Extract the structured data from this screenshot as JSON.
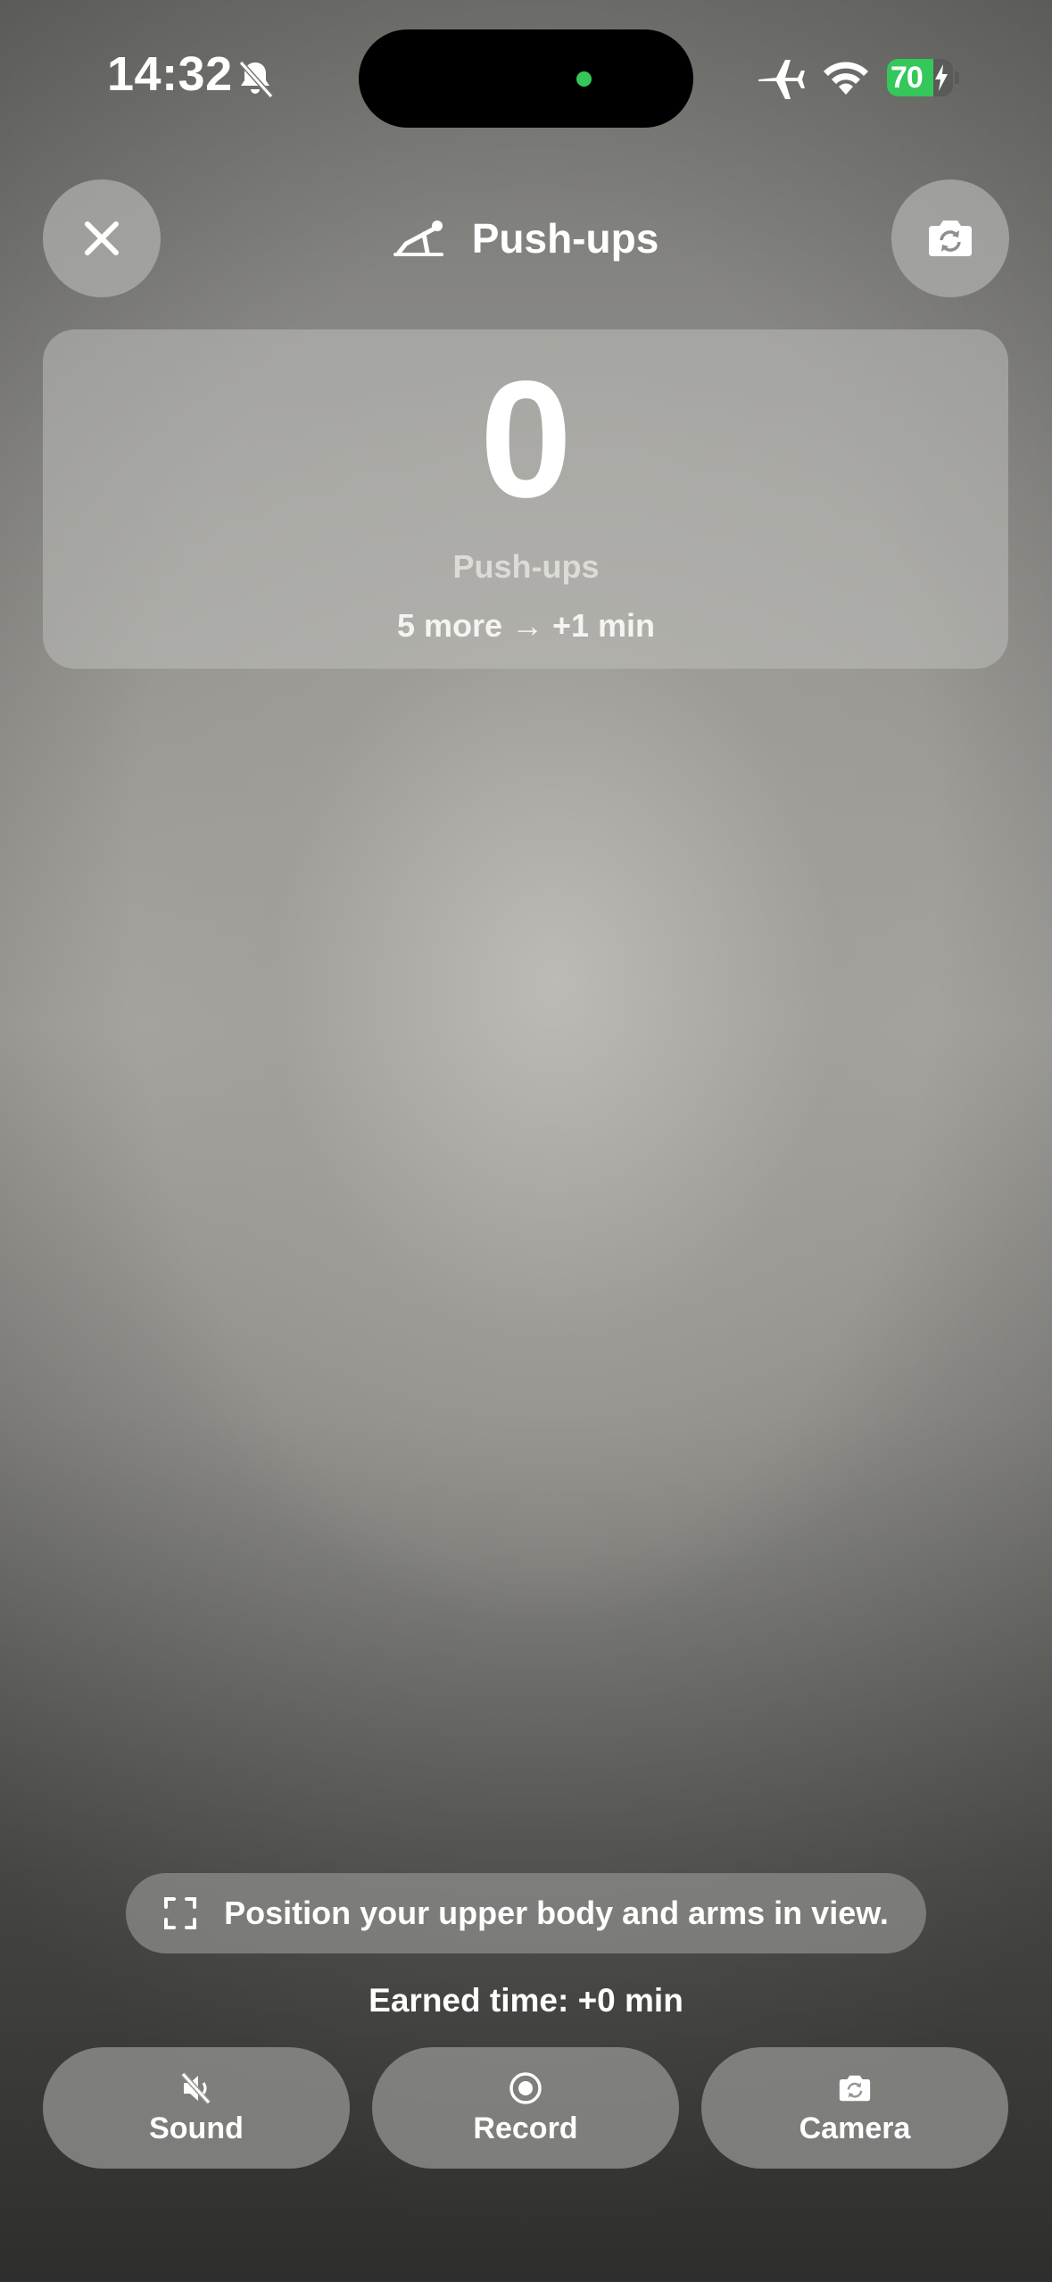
{
  "status_bar": {
    "time": "14:32",
    "battery_percent": "70",
    "battery_level": 0.7,
    "icons": [
      "bell-slash-icon",
      "airplane-icon",
      "wifi-icon",
      "battery-charging-icon"
    ]
  },
  "header": {
    "title": "Push-ups",
    "title_icon": "push-up-icon",
    "close_icon": "close-icon",
    "camera_icon": "camera-flip-icon"
  },
  "counter": {
    "value": "0",
    "label": "Push-ups",
    "hint": "5 more → +1 min"
  },
  "instruction": {
    "icon": "viewfinder-icon",
    "text": "Position your upper body and arms in view."
  },
  "earned_time": "Earned time: +0 min",
  "actions": {
    "sound": {
      "label": "Sound",
      "icon": "speaker-muted-icon"
    },
    "record": {
      "label": "Record",
      "icon": "record-icon"
    },
    "camera": {
      "label": "Camera",
      "icon": "camera-flip-icon"
    }
  },
  "colors": {
    "recording_indicator": "#35c759",
    "battery_fill": "#34c759"
  }
}
